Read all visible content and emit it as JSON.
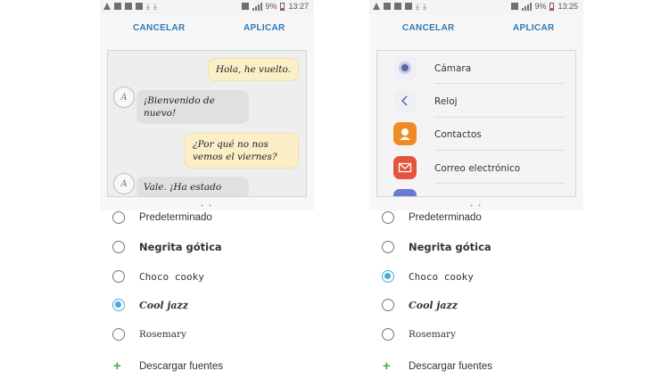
{
  "screens": [
    {
      "status": {
        "battery": "9%",
        "time": "13:27"
      },
      "actions": {
        "cancel": "CANCELAR",
        "apply": "APLICAR"
      },
      "preview": {
        "type": "chat",
        "avatar_letter": "A",
        "messages": [
          {
            "from": "me",
            "text": "Hola, he vuelto."
          },
          {
            "from": "them",
            "text": "¡Bienvenido de nuevo!"
          },
          {
            "from": "me",
            "text": "¿Por qué no nos vemos el viernes?"
          },
          {
            "from": "them",
            "text": "Vale. ¡Ha estado"
          }
        ]
      },
      "page_dots": "• •",
      "fonts": [
        {
          "label": "Predeterminado",
          "selected": false
        },
        {
          "label": "Negrita gótica",
          "selected": false
        },
        {
          "label": "Choco cooky",
          "selected": false
        },
        {
          "label": "Cool jazz",
          "selected": true
        },
        {
          "label": "Rosemary",
          "selected": false
        }
      ],
      "download": "Descargar fuentes"
    },
    {
      "status": {
        "battery": "9%",
        "time": "13:25"
      },
      "actions": {
        "cancel": "CANCELAR",
        "apply": "APLICAR"
      },
      "preview": {
        "type": "apps",
        "apps": [
          {
            "label": "Cámara",
            "icon": "camera-icon",
            "color": "#eef0f6"
          },
          {
            "label": "Reloj",
            "icon": "clock-icon",
            "color": "#eef0f6"
          },
          {
            "label": "Contactos",
            "icon": "contacts-icon",
            "color": "#f08a24"
          },
          {
            "label": "Correo electrónico",
            "icon": "email-icon",
            "color": "#e5533d"
          }
        ]
      },
      "page_dots": "• •",
      "fonts": [
        {
          "label": "Predeterminado",
          "selected": false
        },
        {
          "label": "Negrita gótica",
          "selected": false
        },
        {
          "label": "Choco cooky",
          "selected": true
        },
        {
          "label": "Cool jazz",
          "selected": false
        },
        {
          "label": "Rosemary",
          "selected": false
        }
      ],
      "download": "Descargar fuentes"
    }
  ],
  "colors": {
    "accent": "#2e7ab8",
    "radio_selected": "#4aa9de",
    "download_plus": "#3fb24f"
  }
}
